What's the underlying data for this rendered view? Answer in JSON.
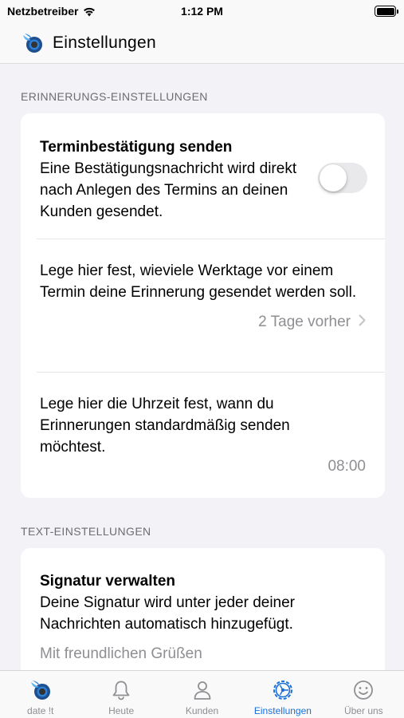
{
  "status_bar": {
    "carrier": "Netzbetreiber",
    "time": "1:12 PM"
  },
  "header": {
    "title": "Einstellungen"
  },
  "sections": {
    "reminder": {
      "header": "ERINNERUNGS-EINSTELLUNGEN",
      "confirmation": {
        "title": "Terminbestätigung senden",
        "description": "Eine Bestätigungsnachricht wird direkt nach Anlegen des Termins an deinen Kunden gesendet.",
        "enabled": false
      },
      "days_before": {
        "description": "Lege hier fest, wieviele Werktage vor einem Termin deine Erinnerung gesendet werden soll.",
        "value": "2 Tage vorher"
      },
      "send_time": {
        "description": "Lege hier die Uhrzeit fest, wann du Erinnerungen standardmäßig senden möchtest.",
        "value": "08:00"
      }
    },
    "text": {
      "header": "TEXT-EINSTELLUNGEN",
      "signature": {
        "title": "Signatur verwalten",
        "description": "Deine Signatur wird unter jeder deiner Nachrichten automatisch hinzugefügt.",
        "value": "Mit freundlichen Grüßen"
      }
    }
  },
  "tabs": [
    {
      "label": "date !t",
      "icon": "app-logo-icon",
      "active": false
    },
    {
      "label": "Heute",
      "icon": "bell-icon",
      "active": false
    },
    {
      "label": "Kunden",
      "icon": "person-icon",
      "active": false
    },
    {
      "label": "Einstellungen",
      "icon": "gear-icon",
      "active": true
    },
    {
      "label": "Über uns",
      "icon": "smiley-icon",
      "active": false
    }
  ],
  "colors": {
    "accent": "#1a6fd9",
    "background": "#f2f2f7",
    "secondary_text": "#8e8e93"
  }
}
